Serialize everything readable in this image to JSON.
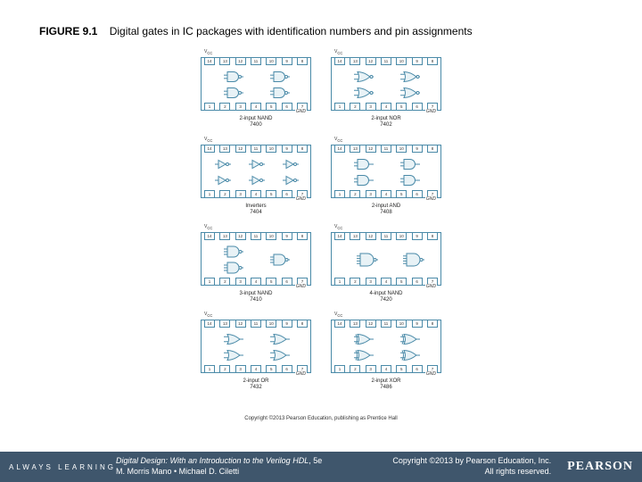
{
  "caption": {
    "label": "FIGURE 9.1",
    "text": "Digital gates in IC packages with identification numbers and pin assignments"
  },
  "pinLabels": {
    "top": [
      "14",
      "13",
      "12",
      "11",
      "10",
      "9",
      "8"
    ],
    "bottom": [
      "1",
      "2",
      "3",
      "4",
      "5",
      "6",
      "7"
    ],
    "vcc": "V_CC",
    "gnd": "GND"
  },
  "chips": [
    {
      "name": "2-input NAND",
      "part": "7400",
      "gate": "nand2",
      "count": 4
    },
    {
      "name": "2-input NOR",
      "part": "7402",
      "gate": "nor2",
      "count": 4
    },
    {
      "name": "Inverters",
      "part": "7404",
      "gate": "inv",
      "count": 6
    },
    {
      "name": "2-input AND",
      "part": "7408",
      "gate": "and2",
      "count": 4
    },
    {
      "name": "3-input NAND",
      "part": "7410",
      "gate": "nand3",
      "count": 3
    },
    {
      "name": "4-input NAND",
      "part": "7420",
      "gate": "nand4",
      "count": 2
    },
    {
      "name": "2-input OR",
      "part": "7432",
      "gate": "or2",
      "count": 4
    },
    {
      "name": "2-input XOR",
      "part": "7486",
      "gate": "xor2",
      "count": 4
    }
  ],
  "figCopyright": "Copyright ©2013 Pearson Education, publishing as Prentice Hall",
  "footer": {
    "always": "ALWAYS LEARNING",
    "bookTitle": "Digital Design: With an Introduction to the Verilog HDL",
    "edition": ", 5e",
    "authors": "M. Morris Mano • Michael D. Ciletti",
    "copyright": "Copyright ©2013 by Pearson Education, Inc.",
    "rights": "All rights reserved.",
    "brand": "PEARSON"
  }
}
